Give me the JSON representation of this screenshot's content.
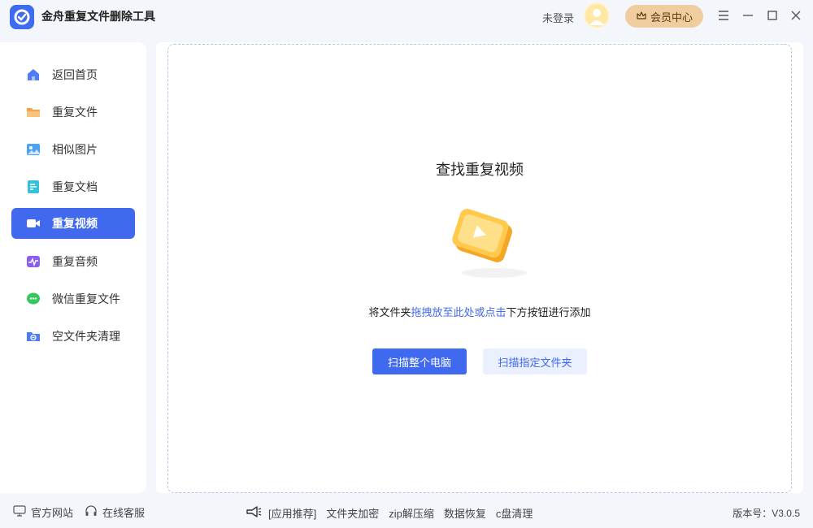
{
  "app": {
    "title": "金舟重复文件删除工具"
  },
  "header": {
    "login_text": "未登录",
    "vip_label": "会员中心"
  },
  "sidebar": {
    "items": [
      {
        "label": "返回首页",
        "icon": "home-icon",
        "color": "#4f7cf6"
      },
      {
        "label": "重复文件",
        "icon": "folder-icon",
        "color": "#f7a14a"
      },
      {
        "label": "相似图片",
        "icon": "image-icon",
        "color": "#4aa3f6"
      },
      {
        "label": "重复文档",
        "icon": "document-icon",
        "color": "#35c1d8"
      },
      {
        "label": "重复视频",
        "icon": "video-icon",
        "color": "#ffffff",
        "active": true
      },
      {
        "label": "重复音频",
        "icon": "audio-icon",
        "color": "#8b5cf6"
      },
      {
        "label": "微信重复文件",
        "icon": "wechat-icon",
        "color": "#34c759"
      },
      {
        "label": "空文件夹清理",
        "icon": "empty-folder-icon",
        "color": "#4f7cf6"
      }
    ]
  },
  "main": {
    "title": "查找重复视频",
    "hint_prefix": "将文件夹",
    "hint_link": "拖拽放至此处或点击",
    "hint_suffix": "下方按钮进行添加",
    "scan_all_label": "扫描整个电脑",
    "scan_folder_label": "扫描指定文件夹"
  },
  "footer": {
    "website_label": "官方网站",
    "service_label": "在线客服",
    "recommend_label": "[应用推荐]",
    "recommend_items": [
      "文件夹加密",
      "zip解压缩",
      "数据恢复",
      "c盘清理"
    ],
    "version": "版本号：V3.0.5"
  },
  "colors": {
    "accent": "#3f6af0",
    "vip": "#f0cd9e"
  }
}
